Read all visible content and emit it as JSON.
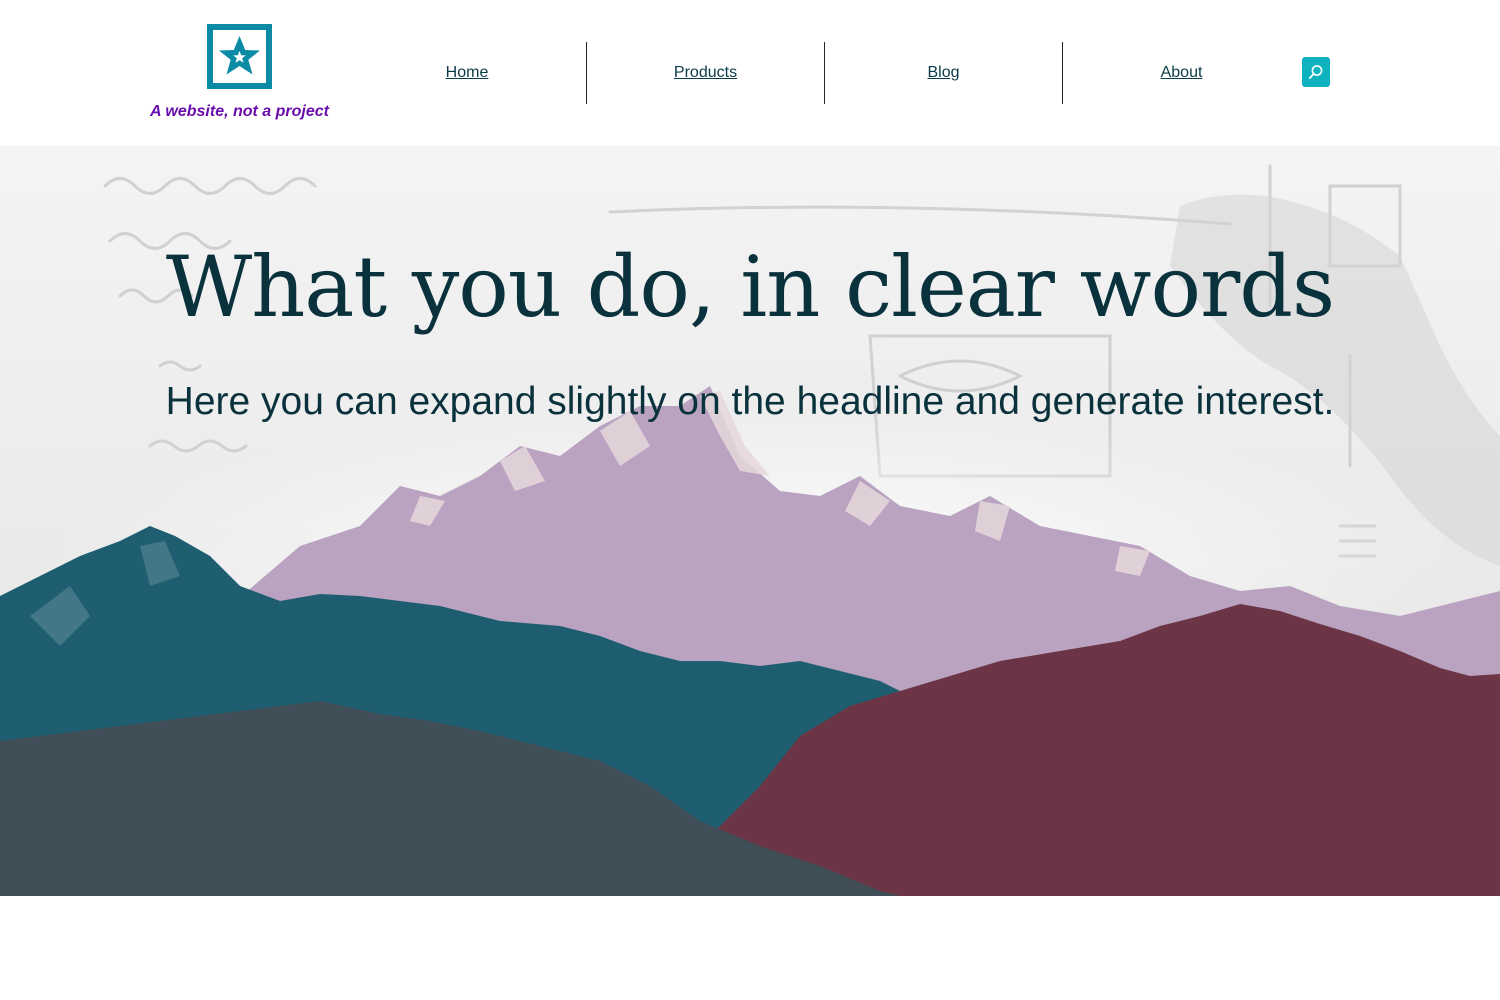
{
  "header": {
    "tagline": "A website, not a project",
    "logo_icon": "star-frame-icon",
    "nav": [
      {
        "label": "Home"
      },
      {
        "label": "Products"
      },
      {
        "label": "Blog"
      },
      {
        "label": "About"
      }
    ],
    "search_icon": "search-icon"
  },
  "hero": {
    "title": "What you do, in clear words",
    "subtitle": "Here you can expand slightly on the headline and generate interest."
  },
  "colors": {
    "brand_teal": "#0a8aa5",
    "tagline_purple": "#6a0dad",
    "heading_dark": "#0a323d",
    "search_bg": "#0fb3be",
    "mountain_teal": "#1f5d70",
    "mountain_red": "#6b3545",
    "mountain_slate": "#404e57",
    "mountain_lavender": "#b9a3c1"
  }
}
